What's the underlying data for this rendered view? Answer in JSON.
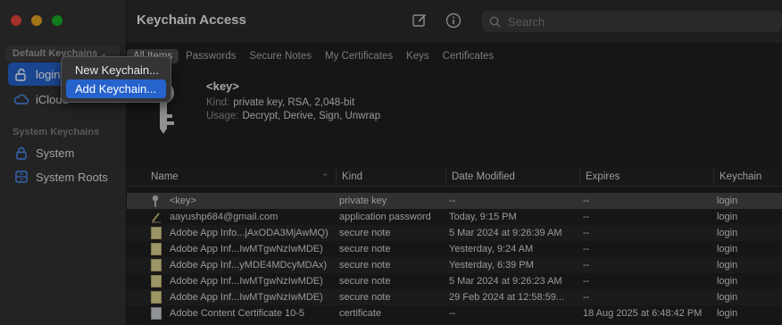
{
  "sidebar": {
    "default_header": "Default Keychains",
    "items": [
      {
        "label": "login",
        "icon": "lock-open-icon"
      },
      {
        "label": "iCloud",
        "icon": "cloud-icon"
      }
    ],
    "system_header": "System Keychains",
    "system_items": [
      {
        "label": "System",
        "icon": "lock-icon"
      },
      {
        "label": "System Roots",
        "icon": "cabinet-icon"
      }
    ]
  },
  "toolbar": {
    "title": "Keychain Access",
    "search_placeholder": "Search"
  },
  "tabs": [
    "All Items",
    "Passwords",
    "Secure Notes",
    "My Certificates",
    "Keys",
    "Certificates"
  ],
  "detail": {
    "title": "<key>",
    "kind_label": "Kind:",
    "kind_value": "private key, RSA, 2,048-bit",
    "usage_label": "Usage:",
    "usage_value": "Decrypt, Derive, Sign, Unwrap"
  },
  "table": {
    "headers": [
      "Name",
      "Kind",
      "Date Modified",
      "Expires",
      "Keychain"
    ],
    "rows": [
      {
        "name": "<key>",
        "kind": "private key",
        "date": "--",
        "expires": "--",
        "keychain": "login",
        "icon": "key-icon"
      },
      {
        "name": "aayushp684@gmail.com",
        "kind": "application password",
        "date": "Today, 9:15 PM",
        "expires": "--",
        "keychain": "login",
        "icon": "pen-icon"
      },
      {
        "name": "Adobe App Info...jAxODA3MjAwMQ)",
        "kind": "secure note",
        "date": "5 Mar 2024 at 9:26:39 AM",
        "expires": "--",
        "keychain": "login",
        "icon": "note-icon"
      },
      {
        "name": "Adobe App Inf...IwMTgwNzIwMDE)",
        "kind": "secure note",
        "date": "Yesterday, 9:24 AM",
        "expires": "--",
        "keychain": "login",
        "icon": "note-icon"
      },
      {
        "name": "Adobe App Inf...yMDE4MDcyMDAx)",
        "kind": "secure note",
        "date": "Yesterday, 6:39 PM",
        "expires": "--",
        "keychain": "login",
        "icon": "note-icon"
      },
      {
        "name": "Adobe App Inf...IwMTgwNzIwMDE)",
        "kind": "secure note",
        "date": "5 Mar 2024 at 9:26:23 AM",
        "expires": "--",
        "keychain": "login",
        "icon": "note-icon"
      },
      {
        "name": "Adobe App Inf...IwMTgwNzIwMDE)",
        "kind": "secure note",
        "date": "29 Feb 2024 at 12:58:59...",
        "expires": "--",
        "keychain": "login",
        "icon": "note-icon"
      },
      {
        "name": "Adobe Content Certificate 10-5",
        "kind": "certificate",
        "date": "--",
        "expires": "18 Aug 2025 at 6:48:42 PM",
        "keychain": "login",
        "icon": "certificate-icon"
      }
    ]
  },
  "popup_menu": {
    "items": [
      "New Keychain...",
      "Add Keychain..."
    ]
  }
}
